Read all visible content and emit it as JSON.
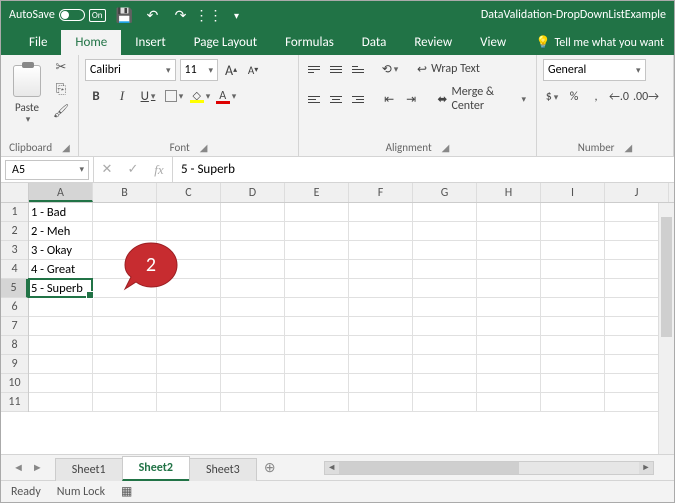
{
  "titlebar": {
    "autosave_label": "AutoSave",
    "autosave_state": "On",
    "doc_title": "DataValidation-DropDownListExample"
  },
  "tabs": {
    "file": "File",
    "home": "Home",
    "insert": "Insert",
    "page_layout": "Page Layout",
    "formulas": "Formulas",
    "data": "Data",
    "review": "Review",
    "view": "View",
    "tell_me": "Tell me what you want"
  },
  "ribbon": {
    "clipboard": {
      "label": "Clipboard",
      "paste": "Paste"
    },
    "font": {
      "label": "Font",
      "family": "Calibri",
      "size": "11",
      "grow": "A",
      "shrink": "A",
      "bold": "B",
      "italic": "I",
      "underline": "U",
      "font_color_letter": "A"
    },
    "alignment": {
      "label": "Alignment",
      "wrap": "Wrap Text",
      "merge": "Merge & Center"
    },
    "number": {
      "label": "Number",
      "format": "General",
      "currency": "$",
      "percent": "%",
      "comma": ",",
      "inc_dec": ".0",
      "dec_dec": ".00"
    }
  },
  "formula_bar": {
    "cell_ref": "A5",
    "fx": "fx",
    "value": "5 - Superb"
  },
  "grid": {
    "columns": [
      "A",
      "B",
      "C",
      "D",
      "E",
      "F",
      "G",
      "H",
      "I",
      "J"
    ],
    "rows": [
      "1",
      "2",
      "3",
      "4",
      "5",
      "6",
      "7",
      "8",
      "9",
      "10",
      "11"
    ],
    "data": {
      "A1": "1 - Bad",
      "A2": "2 - Meh",
      "A3": "3 - Okay",
      "A4": "4 - Great",
      "A5": "5 - Superb"
    },
    "active": {
      "row": 5,
      "col": "A"
    },
    "callout": "2"
  },
  "sheets": {
    "tabs": [
      "Sheet1",
      "Sheet2",
      "Sheet3"
    ],
    "active_index": 1
  },
  "status": {
    "ready": "Ready",
    "numlock": "Num Lock"
  }
}
